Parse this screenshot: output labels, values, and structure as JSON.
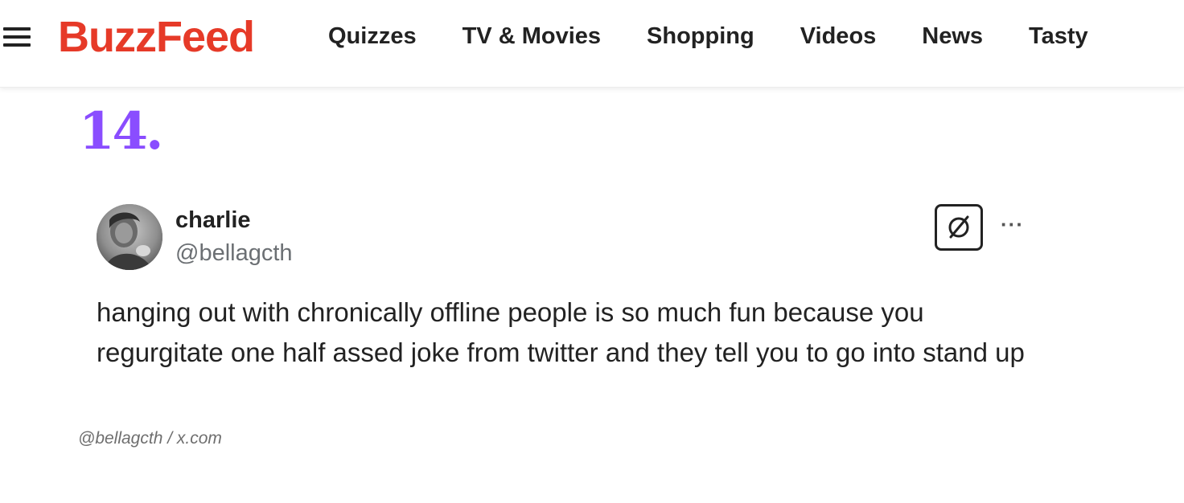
{
  "header": {
    "logo": "BuzzFeed",
    "nav": [
      "Quizzes",
      "TV & Movies",
      "Shopping",
      "Videos",
      "News",
      "Tasty"
    ]
  },
  "item": {
    "number": "14."
  },
  "tweet": {
    "display_name": "charlie",
    "handle": "@bellagcth",
    "text": "hanging out with chronically offline people is so much fun because you regurgitate one half assed joke from twitter and they tell you to go into stand up",
    "more_label": "···"
  },
  "credit": "@bellagcth / x.com",
  "colors": {
    "brand": "#e63a28",
    "number_accent": "#8a4dff",
    "handle_gray": "#6b6f73"
  },
  "icons": {
    "menu": "hamburger-icon",
    "platform": "x-badge-icon",
    "more": "more-dots-icon"
  }
}
